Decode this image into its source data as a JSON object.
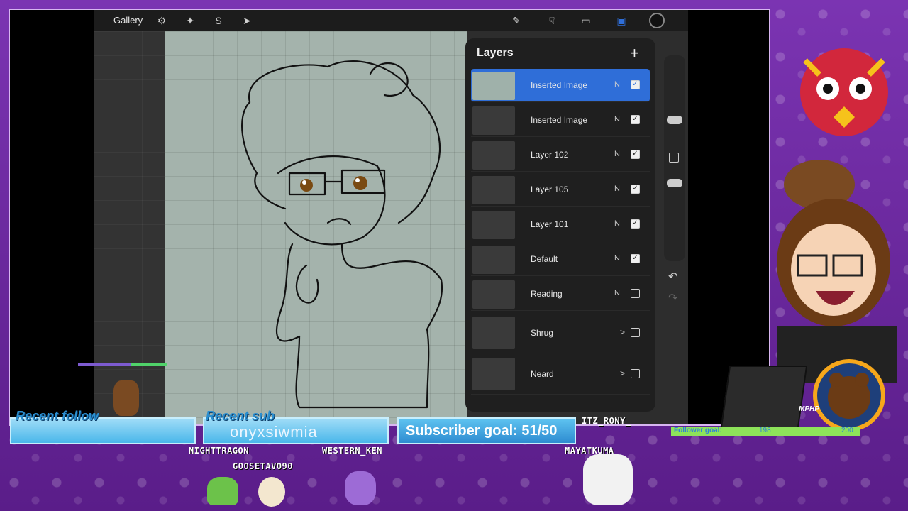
{
  "app": {
    "gallery_label": "Gallery",
    "tools_left": [
      "wrench-icon",
      "magic-wand-icon",
      "selection-icon",
      "transform-icon"
    ],
    "tools_right": [
      "brush-icon",
      "smudge-icon",
      "eraser-icon",
      "layers-icon",
      "color-icon"
    ]
  },
  "layers": {
    "title": "Layers",
    "add_label": "+",
    "items": [
      {
        "name": "Inserted Image",
        "mode": "N",
        "visible": true,
        "selected": true
      },
      {
        "name": "Inserted Image",
        "mode": "N",
        "visible": true
      },
      {
        "name": "Layer 102",
        "mode": "N",
        "visible": true
      },
      {
        "name": "Layer 105",
        "mode": "N",
        "visible": true
      },
      {
        "name": "Layer 101",
        "mode": "N",
        "visible": true
      },
      {
        "name": "Default",
        "mode": "N",
        "visible": true
      },
      {
        "name": "Reading",
        "mode": "N",
        "visible": false
      },
      {
        "name": "Shrug",
        "mode": ">",
        "visible": false,
        "group": true
      },
      {
        "name": "Neard",
        "mode": ">",
        "visible": false,
        "group": true
      }
    ]
  },
  "stream": {
    "recent_follow_label": "Recent follow",
    "recent_sub_label": "Recent sub",
    "recent_sub_name": "onyxsiwmia",
    "subscriber_goal": "Subscriber goal: 51/50",
    "follower_goal_label": "Follower goal:",
    "follower_current": "198",
    "follower_max": "200",
    "mphp_label": "MPHP",
    "chatters": [
      "NIGHTTRAGON",
      "GOOSETAVO90",
      "WESTERN_KEN",
      "ITZ_RONY_",
      "MAYATKUMA"
    ]
  },
  "colors": {
    "accent": "#2f6ed8",
    "canvas": "#a4b3ac",
    "overlay_purple": "#7b34b2",
    "bar_blue": "#4ab7ea",
    "follower_green": "#8ee35a"
  }
}
